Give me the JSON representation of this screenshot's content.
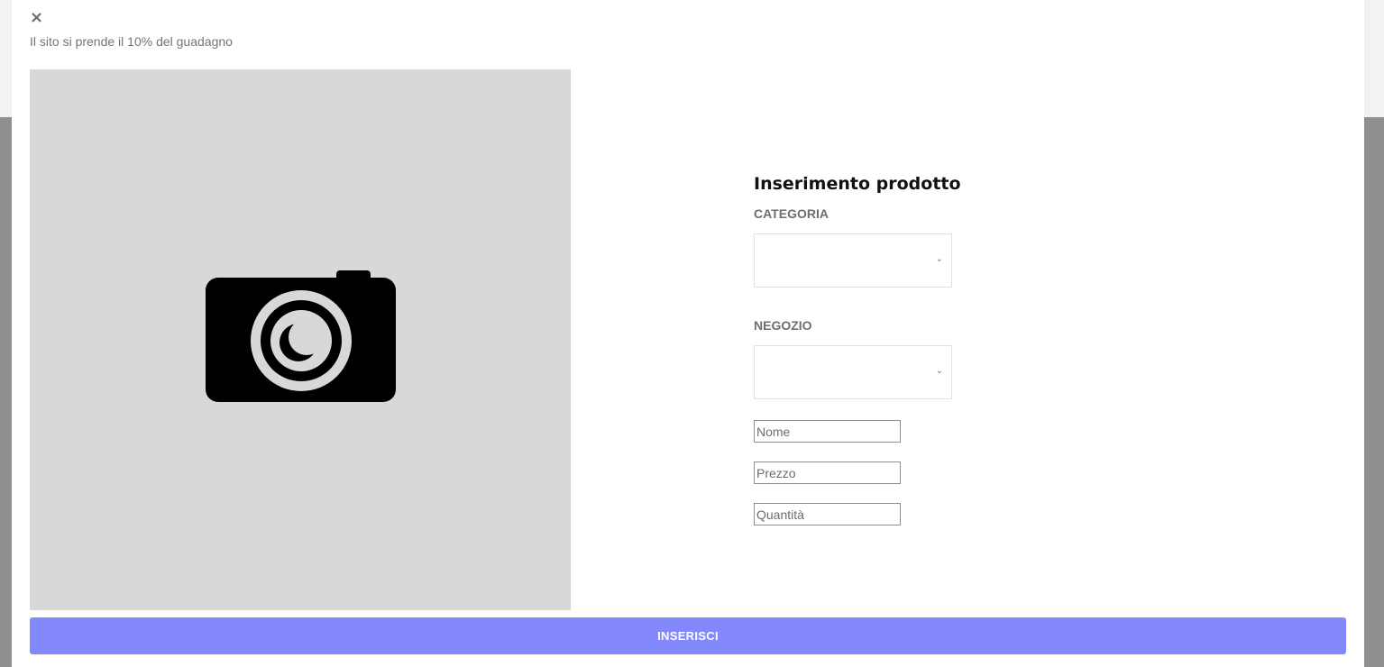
{
  "modal": {
    "close_symbol": "×",
    "fee_note": "Il sito si prende il 10% del guadagno",
    "image_placeholder_icon": "camera-icon",
    "colors": {
      "image_placeholder_bg": "#d8d8d8",
      "submit_bg": "#8389fd",
      "backdrop": "#8f8f8f"
    }
  },
  "form": {
    "title": "Inserimento prodotto",
    "category_label": "CATEGORIA",
    "category_value": "",
    "shop_label": "NEGOZIO",
    "shop_value": "",
    "dropdown_icon": "chevron-down-icon",
    "name_placeholder": "Nome",
    "price_placeholder": "Prezzo",
    "quantity_placeholder": "Quantità",
    "submit_label": "INSERISCI"
  }
}
